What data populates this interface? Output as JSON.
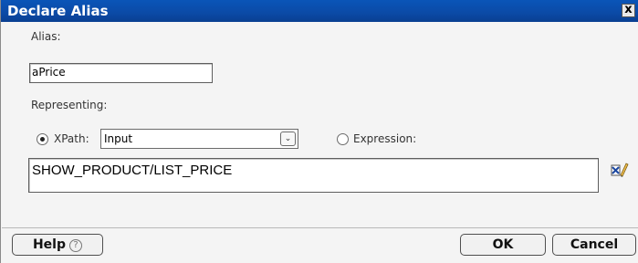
{
  "dialog": {
    "title": "Declare Alias",
    "close_label": "x"
  },
  "alias": {
    "label": "Alias:",
    "value": "aPrice"
  },
  "representing": {
    "label": "Representing:",
    "xpath_label": "XPath:",
    "xpath_selected": true,
    "xpath_value": "Input",
    "expression_label": "Expression:",
    "expression_selected": false,
    "expression_value": "SHOW_PRODUCT/LIST_PRICE"
  },
  "buttons": {
    "help": "Help",
    "help_icon_glyph": "?",
    "ok": "OK",
    "cancel": "Cancel"
  },
  "icons": {
    "edit": "xpath-editor-icon",
    "help": "help-circle-icon",
    "combo_arrow": "chevron-down-icon"
  },
  "colors": {
    "titlebar": "#0b4aa6",
    "background": "#f4f4f4"
  }
}
